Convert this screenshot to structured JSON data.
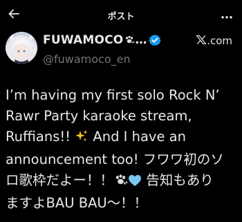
{
  "header": {
    "title": "ポスト",
    "back_icon": "arrow-left-icon",
    "more_icon": "more-dots-icon"
  },
  "author": {
    "display_name": "FUWAMOCO",
    "name_emoji": "paw-prints-icon",
    "truncation": "…",
    "verified": true,
    "handle": "@fuwamoco_en"
  },
  "source": {
    "label": ".com",
    "logo": "x-logo-icon"
  },
  "tweet": {
    "line1": "I’m having my first solo Rock N’",
    "line2": "Rawr Party karaoke stream,",
    "line3": "Ruffians!!",
    "line3_emoji": "sparkles-icon",
    "line3_tail": " And I have an",
    "line4": "announcement too! フワワ初のソ",
    "line5_start": "ロ歌枠だよー！！",
    "line5_emoji1": "paw-prints-icon",
    "line5_emoji2": "light-blue-heart-icon",
    "line5_end": " 告知もあり",
    "line6": "ますよBAU BAU～！！"
  },
  "colors": {
    "background": "#000000",
    "text": "#e7e9ea",
    "secondary_text": "#71767b",
    "verified_blue": "#1d9bf0",
    "heart_blue": "#7dc7f0",
    "sparkle_yellow": "#f5c518"
  }
}
